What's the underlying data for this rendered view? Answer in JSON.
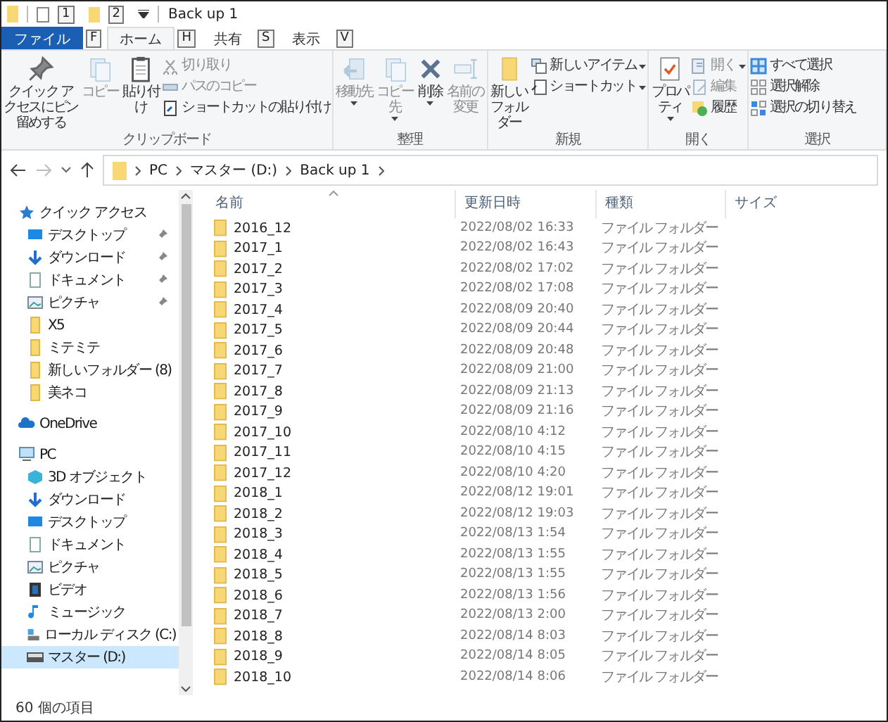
{
  "window": {
    "title": "Back up 1",
    "quick_access_key_tips": [
      "1",
      "2"
    ]
  },
  "tabs": [
    {
      "label": "ファイル",
      "key_tip": "F",
      "kind": "file",
      "selected": false
    },
    {
      "label": "ホーム",
      "key_tip": "H",
      "kind": "tab",
      "selected": true
    },
    {
      "label": "共有",
      "key_tip": "S",
      "kind": "tab",
      "selected": false
    },
    {
      "label": "表示",
      "key_tip": "V",
      "kind": "tab",
      "selected": false
    }
  ],
  "ribbon": {
    "groups": [
      {
        "label": "クリップボード",
        "buttons": [
          {
            "label": "クイック アクセスにピン留めする",
            "kind": "large",
            "disabled": false,
            "dropdown": false
          },
          {
            "label": "コピー",
            "kind": "large",
            "disabled": true,
            "dropdown": false
          },
          {
            "label": "貼り付け",
            "kind": "large",
            "disabled": false,
            "dropdown": false
          },
          {
            "label": "切り取り",
            "kind": "small",
            "disabled": true,
            "dropdown": false
          },
          {
            "label": "パスのコピー",
            "kind": "small",
            "disabled": true,
            "dropdown": false
          },
          {
            "label": "ショートカットの貼り付け",
            "kind": "small",
            "disabled": false,
            "dropdown": false
          }
        ]
      },
      {
        "label": "整理",
        "buttons": [
          {
            "label": "移動先",
            "kind": "large",
            "disabled": true,
            "dropdown": true
          },
          {
            "label": "コピー先",
            "kind": "large",
            "disabled": true,
            "dropdown": true
          },
          {
            "label": "削除",
            "kind": "large",
            "disabled": false,
            "dropdown": true
          },
          {
            "label": "名前の変更",
            "kind": "large",
            "disabled": true,
            "dropdown": false
          }
        ]
      },
      {
        "label": "新規",
        "buttons": [
          {
            "label": "新しいフォルダー",
            "kind": "large",
            "disabled": false,
            "dropdown": false
          },
          {
            "label": "新しいアイテム",
            "kind": "small",
            "disabled": false,
            "dropdown": true
          },
          {
            "label": "ショートカット",
            "kind": "small",
            "disabled": false,
            "dropdown": true
          }
        ]
      },
      {
        "label": "開く",
        "buttons": [
          {
            "label": "プロパティ",
            "kind": "large",
            "disabled": false,
            "dropdown": true
          },
          {
            "label": "開く",
            "kind": "small",
            "disabled": true,
            "dropdown": true
          },
          {
            "label": "編集",
            "kind": "small",
            "disabled": true,
            "dropdown": false
          },
          {
            "label": "履歴",
            "kind": "small",
            "disabled": false,
            "dropdown": false
          }
        ]
      },
      {
        "label": "選択",
        "buttons": [
          {
            "label": "すべて選択",
            "kind": "small",
            "disabled": false,
            "dropdown": false
          },
          {
            "label": "選択解除",
            "kind": "small",
            "disabled": false,
            "dropdown": false
          },
          {
            "label": "選択の切り替え",
            "kind": "small",
            "disabled": false,
            "dropdown": false
          }
        ]
      }
    ]
  },
  "address_bar": {
    "path": [
      "PC",
      "マスター (D:)",
      "Back up 1"
    ]
  },
  "sidebar": {
    "items": [
      {
        "label": "クイック アクセス",
        "kind": "quick",
        "selected": false,
        "children": [
          {
            "label": "デスクトップ",
            "kind": "desktop",
            "pinned": true,
            "selected": false
          },
          {
            "label": "ダウンロード",
            "kind": "download",
            "pinned": true,
            "selected": false
          },
          {
            "label": "ドキュメント",
            "kind": "document",
            "pinned": true,
            "selected": false
          },
          {
            "label": "ピクチャ",
            "kind": "picture",
            "pinned": true,
            "selected": false
          },
          {
            "label": "X5",
            "kind": "folder",
            "pinned": false,
            "selected": false
          },
          {
            "label": "ミテミテ",
            "kind": "folder",
            "pinned": false,
            "selected": false
          },
          {
            "label": "新しいフォルダー (8)",
            "kind": "folder",
            "pinned": false,
            "selected": false
          },
          {
            "label": "美ネコ",
            "kind": "folder",
            "pinned": false,
            "selected": false
          }
        ]
      },
      {
        "label": "OneDrive",
        "kind": "cloud",
        "selected": false
      },
      {
        "label": "PC",
        "kind": "pc",
        "selected": false,
        "children": [
          {
            "label": "3D オブジェクト",
            "kind": "cube",
            "pinned": false,
            "selected": false
          },
          {
            "label": "ダウンロード",
            "kind": "download",
            "pinned": false,
            "selected": false
          },
          {
            "label": "デスクトップ",
            "kind": "desktop",
            "pinned": false,
            "selected": false
          },
          {
            "label": "ドキュメント",
            "kind": "document",
            "pinned": false,
            "selected": false
          },
          {
            "label": "ピクチャ",
            "kind": "picture",
            "pinned": false,
            "selected": false
          },
          {
            "label": "ビデオ",
            "kind": "video",
            "pinned": false,
            "selected": false
          },
          {
            "label": "ミュージック",
            "kind": "music",
            "pinned": false,
            "selected": false
          },
          {
            "label": "ローカル ディスク (C:)",
            "kind": "disk",
            "pinned": false,
            "selected": false
          },
          {
            "label": "マスター (D:)",
            "kind": "drive",
            "pinned": false,
            "selected": true
          }
        ]
      }
    ]
  },
  "file_list": {
    "columns": [
      "名前",
      "更新日時",
      "種類",
      "サイズ"
    ],
    "rows": [
      {
        "name": "2016_12",
        "modified": "2022/08/02 16:33",
        "type": "ファイル フォルダー"
      },
      {
        "name": "2017_1",
        "modified": "2022/08/02 16:43",
        "type": "ファイル フォルダー"
      },
      {
        "name": "2017_2",
        "modified": "2022/08/02 17:02",
        "type": "ファイル フォルダー"
      },
      {
        "name": "2017_3",
        "modified": "2022/08/02 17:08",
        "type": "ファイル フォルダー"
      },
      {
        "name": "2017_4",
        "modified": "2022/08/09 20:40",
        "type": "ファイル フォルダー"
      },
      {
        "name": "2017_5",
        "modified": "2022/08/09 20:44",
        "type": "ファイル フォルダー"
      },
      {
        "name": "2017_6",
        "modified": "2022/08/09 20:48",
        "type": "ファイル フォルダー"
      },
      {
        "name": "2017_7",
        "modified": "2022/08/09 21:00",
        "type": "ファイル フォルダー"
      },
      {
        "name": "2017_8",
        "modified": "2022/08/09 21:13",
        "type": "ファイル フォルダー"
      },
      {
        "name": "2017_9",
        "modified": "2022/08/09 21:16",
        "type": "ファイル フォルダー"
      },
      {
        "name": "2017_10",
        "modified": "2022/08/10 4:12",
        "type": "ファイル フォルダー"
      },
      {
        "name": "2017_11",
        "modified": "2022/08/10 4:15",
        "type": "ファイル フォルダー"
      },
      {
        "name": "2017_12",
        "modified": "2022/08/10 4:20",
        "type": "ファイル フォルダー"
      },
      {
        "name": "2018_1",
        "modified": "2022/08/12 19:01",
        "type": "ファイル フォルダー"
      },
      {
        "name": "2018_2",
        "modified": "2022/08/12 19:03",
        "type": "ファイル フォルダー"
      },
      {
        "name": "2018_3",
        "modified": "2022/08/13 1:54",
        "type": "ファイル フォルダー"
      },
      {
        "name": "2018_4",
        "modified": "2022/08/13 1:55",
        "type": "ファイル フォルダー"
      },
      {
        "name": "2018_5",
        "modified": "2022/08/13 1:55",
        "type": "ファイル フォルダー"
      },
      {
        "name": "2018_6",
        "modified": "2022/08/13 1:56",
        "type": "ファイル フォルダー"
      },
      {
        "name": "2018_7",
        "modified": "2022/08/13 2:00",
        "type": "ファイル フォルダー"
      },
      {
        "name": "2018_8",
        "modified": "2022/08/14 8:03",
        "type": "ファイル フォルダー"
      },
      {
        "name": "2018_9",
        "modified": "2022/08/14 8:05",
        "type": "ファイル フォルダー"
      },
      {
        "name": "2018_10",
        "modified": "2022/08/14 8:06",
        "type": "ファイル フォルダー"
      }
    ]
  },
  "status_bar": {
    "item_count": "60 個の項目"
  }
}
